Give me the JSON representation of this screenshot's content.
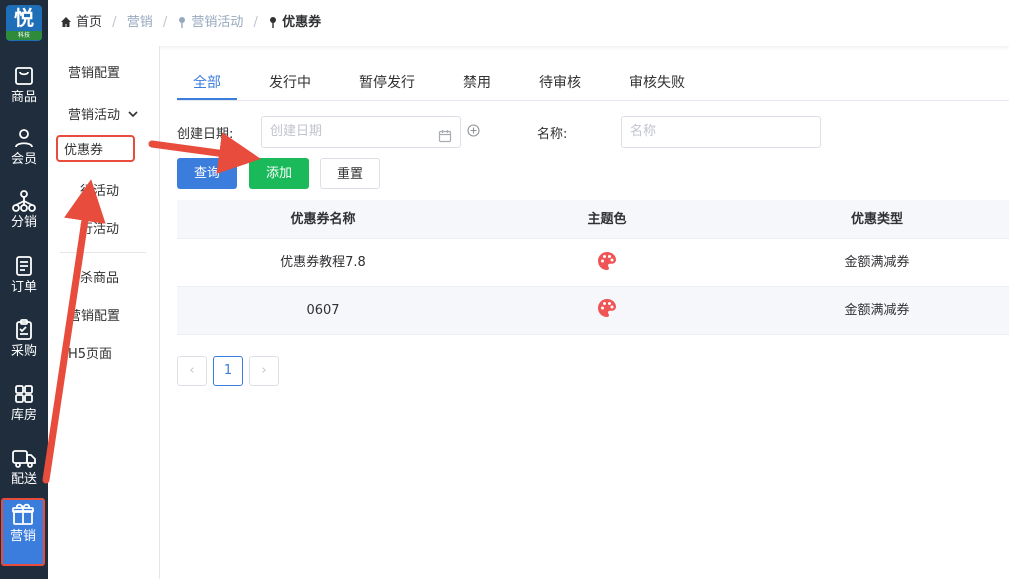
{
  "logo": {
    "glyph": "悦",
    "caption": "科技"
  },
  "nav": [
    {
      "label": "商品",
      "icon": "bag-icon"
    },
    {
      "label": "会员",
      "icon": "user-icon"
    },
    {
      "label": "分销",
      "icon": "network-icon"
    },
    {
      "label": "订单",
      "icon": "document-icon"
    },
    {
      "label": "采购",
      "icon": "clipboard-icon"
    },
    {
      "label": "库房",
      "icon": "grid-icon"
    },
    {
      "label": "配送",
      "icon": "truck-icon"
    },
    {
      "label": "营销",
      "icon": "gift-icon",
      "active": true
    }
  ],
  "breadcrumb": {
    "home": "首页",
    "l1": "营销",
    "l2": "营销活动",
    "current": "优惠券"
  },
  "submenu": {
    "marketing_config": "营销配置",
    "marketing_activity": "营销活动",
    "coupon": "优惠券",
    "item_a": "行活动",
    "item_b": "行活动",
    "item_c": "杀商品",
    "item_d": "营销配置",
    "item_e": "H5页面"
  },
  "tabs": [
    "全部",
    "发行中",
    "暂停发行",
    "禁用",
    "待审核",
    "审核失败"
  ],
  "filters": {
    "date_label": "创建日期:",
    "date_placeholder": "创建日期",
    "name_label": "名称:",
    "name_placeholder": "名称"
  },
  "buttons": {
    "query": "查询",
    "add": "添加",
    "reset": "重置"
  },
  "table": {
    "headers": [
      "优惠券名称",
      "主题色",
      "优惠类型"
    ],
    "rows": [
      {
        "name": "优惠券教程7.8",
        "type": "金额满减券"
      },
      {
        "name": "0607",
        "type": "金额满减券"
      }
    ]
  },
  "pagination": {
    "prev": "‹",
    "page": "1",
    "next": "›"
  },
  "colors": {
    "primary": "#3b7ddd",
    "success": "#1aba5b",
    "highlight": "#e74c3c",
    "nav_bg": "#1f2d3d"
  }
}
